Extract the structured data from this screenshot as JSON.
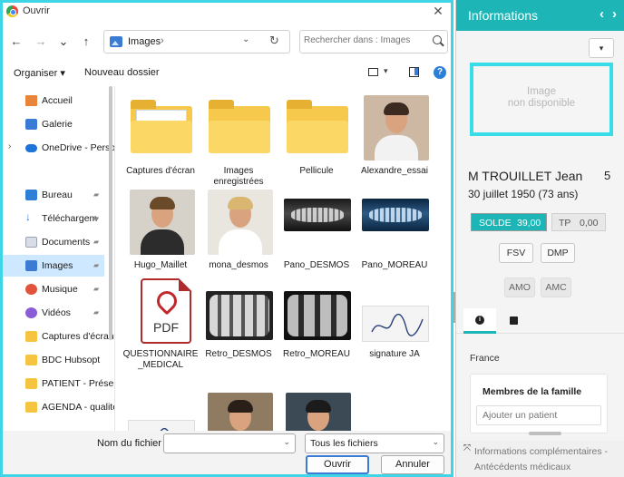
{
  "dialog": {
    "title": "Ouvrir",
    "close_glyph": "✕",
    "nav": {
      "back": "←",
      "forward": "→",
      "recent": "⌄",
      "up": "↑"
    },
    "address": {
      "crumb": "Images",
      "sep": "›",
      "dropdown": "⌄",
      "refresh": "↻"
    },
    "search": {
      "placeholder": "Rechercher dans : Images"
    },
    "toolbar": {
      "organize": "Organiser ▾",
      "new_folder": "Nouveau dossier",
      "view_dd": "▾",
      "help": "?"
    },
    "sidebar": [
      {
        "label": "Accueil",
        "icon": "home-icon",
        "chev": "",
        "pinned": false,
        "active": false
      },
      {
        "label": "Galerie",
        "icon": "gallery-icon",
        "chev": "",
        "pinned": false,
        "active": false
      },
      {
        "label": "OneDrive - Perso",
        "icon": "cloud-icon",
        "chev": "›",
        "pinned": false,
        "active": false
      },
      {
        "label": "Bureau",
        "icon": "desktop-icon",
        "chev": "",
        "pinned": true,
        "active": false
      },
      {
        "label": "Téléchargem",
        "icon": "download-icon",
        "chev": "",
        "pinned": true,
        "active": false
      },
      {
        "label": "Documents",
        "icon": "documents-icon",
        "chev": "",
        "pinned": true,
        "active": false
      },
      {
        "label": "Images",
        "icon": "images-icon",
        "chev": "",
        "pinned": true,
        "active": true
      },
      {
        "label": "Musique",
        "icon": "music-icon",
        "chev": "",
        "pinned": true,
        "active": false
      },
      {
        "label": "Vidéos",
        "icon": "videos-icon",
        "chev": "",
        "pinned": true,
        "active": false
      },
      {
        "label": "Captures d'écran",
        "icon": "folder-icon",
        "chev": "",
        "pinned": false,
        "active": false
      },
      {
        "label": "BDC Hubsopt",
        "icon": "folder-icon",
        "chev": "",
        "pinned": false,
        "active": false
      },
      {
        "label": "PATIENT - Présentation",
        "icon": "folder-icon",
        "chev": "",
        "pinned": false,
        "active": false
      },
      {
        "label": "AGENDA - qualité",
        "icon": "folder-icon",
        "chev": "",
        "pinned": false,
        "active": false
      }
    ],
    "pin_glyph": "📌",
    "files": [
      {
        "name": "Captures d'écran",
        "kind": "folder-with-paper"
      },
      {
        "name": "Images enregistrées",
        "kind": "folder"
      },
      {
        "name": "Pellicule",
        "kind": "folder"
      },
      {
        "name": "Alexandre_essai",
        "kind": "photo"
      },
      {
        "name": "Hugo_Maillet",
        "kind": "photo"
      },
      {
        "name": "mona_desmos",
        "kind": "photo"
      },
      {
        "name": "Pano_DESMOS",
        "kind": "xray-pano"
      },
      {
        "name": "Pano_MOREAU",
        "kind": "xray-pano-blue"
      },
      {
        "name": "QUESTIONNAIRE _MEDICAL",
        "kind": "pdf"
      },
      {
        "name": "Retro_DESMOS",
        "kind": "xray-retro"
      },
      {
        "name": "Retro_MOREAU",
        "kind": "xray-retro-dark"
      },
      {
        "name": "signature JA",
        "kind": "signature"
      },
      {
        "name": "",
        "kind": "signature"
      },
      {
        "name": "",
        "kind": "photo"
      },
      {
        "name": "",
        "kind": "photo"
      }
    ],
    "pdf_label": "PDF",
    "bottom": {
      "filename_label": "Nom du fichier :",
      "filename_value": "",
      "filetype": "Tous les fichiers",
      "dd": "⌄",
      "open": "Ouvrir",
      "cancel": "Annuler"
    }
  },
  "panel": {
    "title": "Informations",
    "prev": "‹",
    "next": "›",
    "dropdown": "▾",
    "no_photo_line1": "Image",
    "no_photo_line2": "non disponible",
    "patient_name": "M TROUILLET Jean",
    "patient_number": "5",
    "patient_dob": "30 juillet 1950 (73 ans)",
    "solde_label": "SOLDE",
    "solde_value": "39,00",
    "tp_label": "TP",
    "tp_value": "0,00",
    "fsv": "FSV",
    "dmp": "DMP",
    "amo": "AMO",
    "amc": "AMC",
    "tab_info": "i",
    "country": "France",
    "family_title": "Membres de la famille",
    "family_placeholder": "Ajouter un patient",
    "extra_line1": "Informations complémentaires -",
    "extra_line2": "Antécédents médicaux",
    "extra_icon": "⤧"
  },
  "colors": {
    "accent": "#1db5b6",
    "selection": "#cde8ff",
    "highlight_border": "#39dde8"
  }
}
